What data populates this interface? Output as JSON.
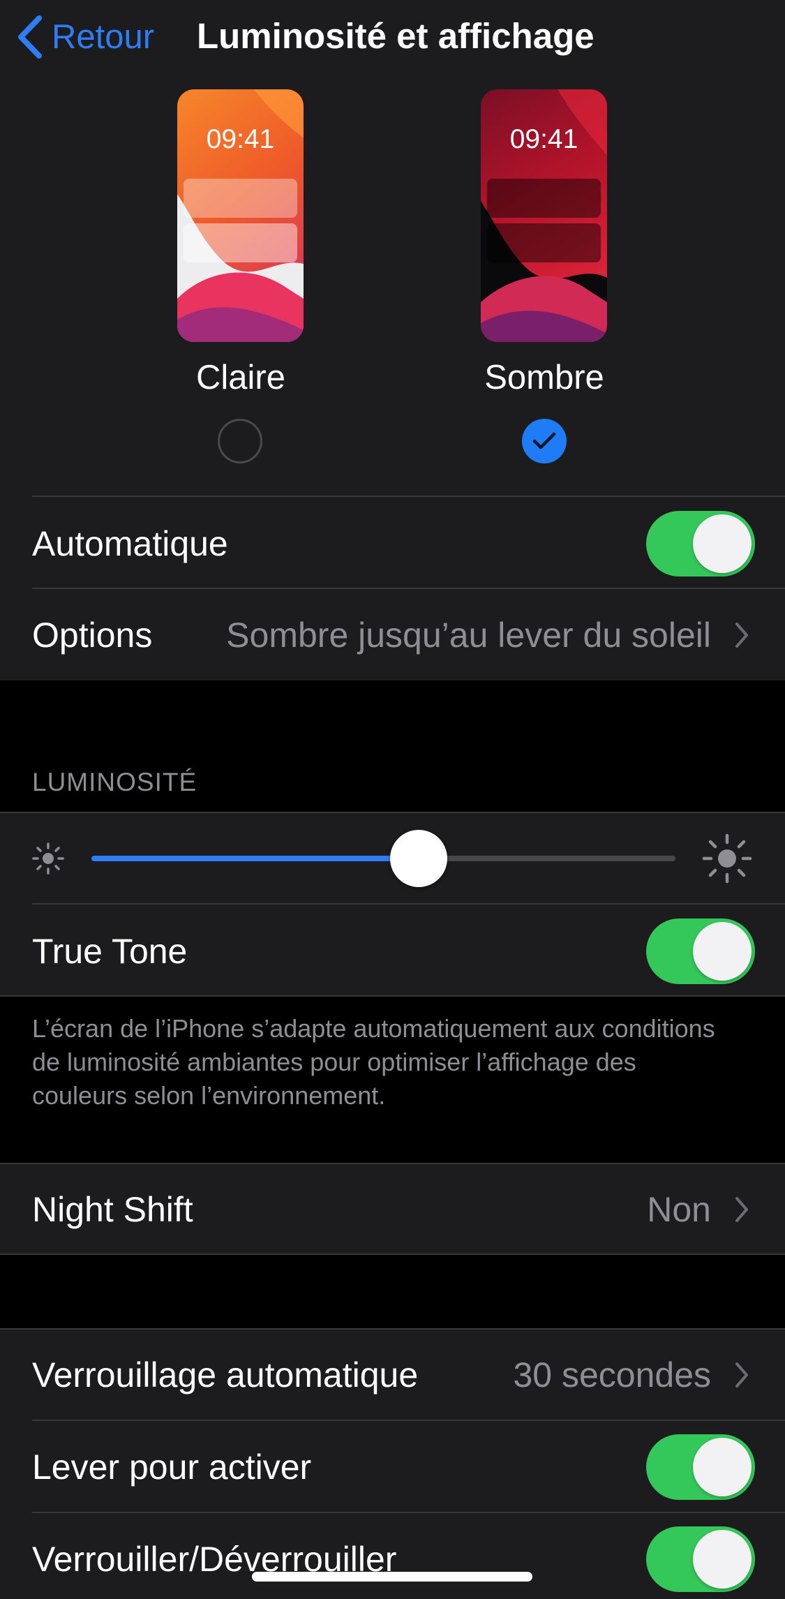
{
  "nav": {
    "back_label": "Retour",
    "title": "Luminosité et affichage"
  },
  "appearance": {
    "light": {
      "label": "Claire",
      "time": "09:41",
      "selected": false
    },
    "dark": {
      "label": "Sombre",
      "time": "09:41",
      "selected": true
    },
    "automatic": {
      "label": "Automatique",
      "on": true
    },
    "options": {
      "label": "Options",
      "value": "Sombre jusqu’au lever du soleil"
    }
  },
  "brightness": {
    "header": "LUMINOSITÉ",
    "level": 0.56,
    "true_tone": {
      "label": "True Tone",
      "on": true
    },
    "footer": "L’écran de l’iPhone s’adapte automatiquement aux conditions de luminosité ambiantes pour optimiser l’affichage des couleurs selon l’environnement."
  },
  "night_shift": {
    "label": "Night Shift",
    "value": "Non"
  },
  "lock": {
    "auto_lock": {
      "label": "Verrouillage automatique",
      "value": "30 secondes"
    },
    "raise_to_wake": {
      "label": "Lever pour activer",
      "on": true
    },
    "lock_unlock": {
      "label": "Verrouiller/Déverrouiller",
      "on": true
    }
  },
  "colors": {
    "accent": "#2f7df6",
    "toggle_on": "#34c759",
    "group_bg": "#1c1c1e",
    "secondary_text": "#8e8e93"
  },
  "icons": {
    "back": "chevron-left-icon",
    "disclosure": "chevron-right-icon",
    "brightness_low": "sun-small-icon",
    "brightness_high": "sun-large-icon",
    "selected": "checkmark-icon"
  }
}
